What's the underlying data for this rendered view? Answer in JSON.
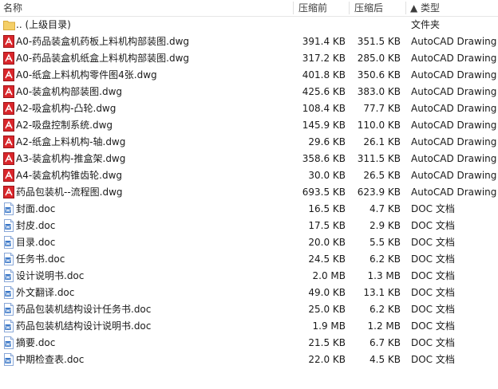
{
  "header": {
    "name": "名称",
    "before": "压缩前",
    "after": "压缩后",
    "type": "▲ 类型"
  },
  "parent": {
    "name": ".. (上级目录)",
    "type": "文件夹",
    "icon": "folder-icon"
  },
  "files": [
    {
      "name": "A0-药品装盒机药板上料机构部装图.dwg",
      "before": "391.4 KB",
      "after": "351.5 KB",
      "type": "AutoCAD Drawing",
      "icon": "dwg-icon"
    },
    {
      "name": "A0-药品装盒机纸盒上料机构部装图.dwg",
      "before": "317.2 KB",
      "after": "285.0 KB",
      "type": "AutoCAD Drawing",
      "icon": "dwg-icon"
    },
    {
      "name": "A0-纸盒上料机构零件图4张.dwg",
      "before": "401.8 KB",
      "after": "350.6 KB",
      "type": "AutoCAD Drawing",
      "icon": "dwg-icon"
    },
    {
      "name": "A0-装盒机构部装图.dwg",
      "before": "425.6 KB",
      "after": "383.0 KB",
      "type": "AutoCAD Drawing",
      "icon": "dwg-icon"
    },
    {
      "name": "A2-吸盒机构-凸轮.dwg",
      "before": "108.4 KB",
      "after": "77.7 KB",
      "type": "AutoCAD Drawing",
      "icon": "dwg-icon"
    },
    {
      "name": "A2-吸盘控制系统.dwg",
      "before": "145.9 KB",
      "after": "110.0 KB",
      "type": "AutoCAD Drawing",
      "icon": "dwg-icon"
    },
    {
      "name": "A2-纸盒上料机构-轴.dwg",
      "before": "29.6 KB",
      "after": "26.1 KB",
      "type": "AutoCAD Drawing",
      "icon": "dwg-icon"
    },
    {
      "name": "A3-装盒机构-推盒架.dwg",
      "before": "358.6 KB",
      "after": "311.5 KB",
      "type": "AutoCAD Drawing",
      "icon": "dwg-icon"
    },
    {
      "name": "A4-装盒机构锥齿轮.dwg",
      "before": "30.0 KB",
      "after": "26.5 KB",
      "type": "AutoCAD Drawing",
      "icon": "dwg-icon"
    },
    {
      "name": "药品包装机--流程图.dwg",
      "before": "693.5 KB",
      "after": "623.9 KB",
      "type": "AutoCAD Drawing",
      "icon": "dwg-icon"
    },
    {
      "name": "封面.doc",
      "before": "16.5 KB",
      "after": "4.7 KB",
      "type": "DOC 文档",
      "icon": "doc-icon"
    },
    {
      "name": "封皮.doc",
      "before": "17.5 KB",
      "after": "2.9 KB",
      "type": "DOC 文档",
      "icon": "doc-icon"
    },
    {
      "name": "目录.doc",
      "before": "20.0 KB",
      "after": "5.5 KB",
      "type": "DOC 文档",
      "icon": "doc-icon"
    },
    {
      "name": "任务书.doc",
      "before": "24.5 KB",
      "after": "6.2 KB",
      "type": "DOC 文档",
      "icon": "doc-icon"
    },
    {
      "name": "设计说明书.doc",
      "before": "2.0 MB",
      "after": "1.3 MB",
      "type": "DOC 文档",
      "icon": "doc-icon"
    },
    {
      "name": "外文翻译.doc",
      "before": "49.0 KB",
      "after": "13.1 KB",
      "type": "DOC 文档",
      "icon": "doc-icon"
    },
    {
      "name": "药品包装机结构设计任务书.doc",
      "before": "25.0 KB",
      "after": "6.2 KB",
      "type": "DOC 文档",
      "icon": "doc-icon"
    },
    {
      "name": "药品包装机结构设计说明书.doc",
      "before": "1.9 MB",
      "after": "1.2 MB",
      "type": "DOC 文档",
      "icon": "doc-icon"
    },
    {
      "name": "摘要.doc",
      "before": "21.5 KB",
      "after": "6.7 KB",
      "type": "DOC 文档",
      "icon": "doc-icon"
    },
    {
      "name": "中期检查表.doc",
      "before": "22.0 KB",
      "after": "4.5 KB",
      "type": "DOC 文档",
      "icon": "doc-icon"
    }
  ],
  "colors": {
    "dwg_icon": "#d9262b",
    "doc_icon": "#2e6fc4",
    "folder_icon": "#f4cf68"
  }
}
